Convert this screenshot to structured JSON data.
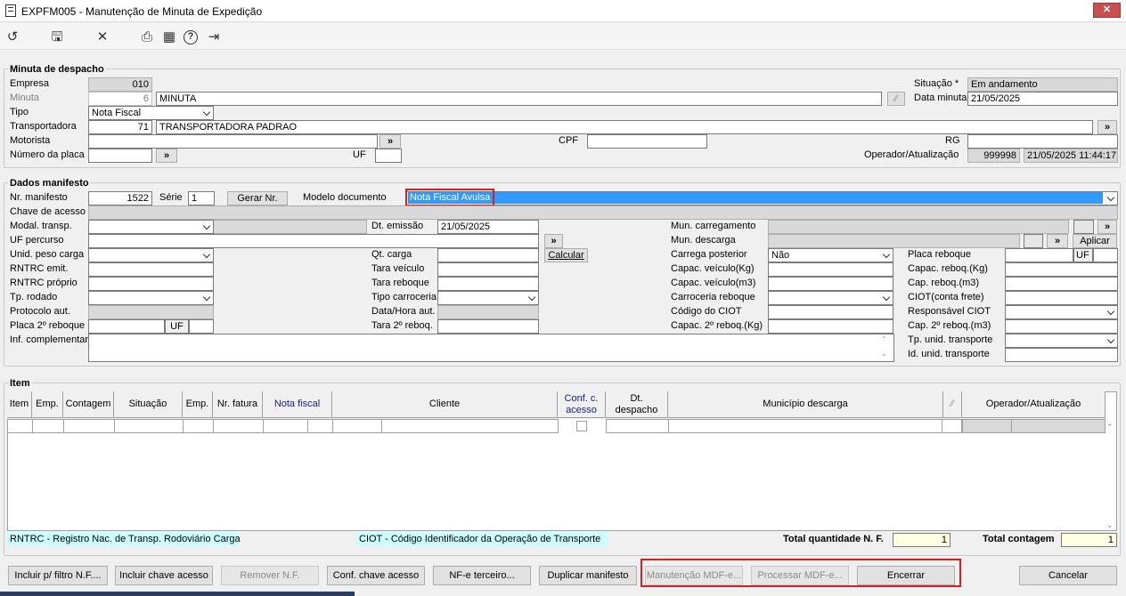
{
  "window": {
    "title": "EXPFM005 - Manutenção de Minuta de Expedição",
    "close": "✕"
  },
  "toolbar": {
    "icons": [
      "refresh-icon",
      "save-icon",
      "cancel-icon",
      "print-icon",
      "calendar-icon",
      "help-icon",
      "exit-icon"
    ],
    "glyphs": [
      "↺",
      "🖫",
      "✕",
      "⎙",
      "▦",
      "?",
      "⇥"
    ]
  },
  "minuta": {
    "title": "Minuta de despacho",
    "empresa_label": "Empresa",
    "empresa": "010",
    "minuta_label": "Minuta",
    "minuta_num": "6",
    "minuta_desc": "MINUTA",
    "tipo_label": "Tipo",
    "tipo": "Nota Fiscal",
    "transp_label": "Transportadora",
    "transp_code": "71",
    "transp_name": "TRANSPORTADORA PADRAO",
    "motorista_label": "Motorista",
    "cpf_label": "CPF",
    "rg_label": "RG",
    "placa_label": "Número da placa",
    "uf_label": "UF",
    "situacao_label": "Situação *",
    "situacao": "Em andamento",
    "data_label": "Data minuta",
    "data": "21/05/2025",
    "operador_label": "Operador/Atualização",
    "operador": "999998",
    "operador_dt": "21/05/2025 11:44:17"
  },
  "manifesto": {
    "title": "Dados manifesto",
    "nr_label": "Nr. manifesto",
    "nr": "1522",
    "serie_label": "Série",
    "serie": "1",
    "gerar": "Gerar Nr.",
    "modelo_label": "Modelo documento",
    "modelo": "Nota Fiscal Avulsa",
    "chave_label": "Chave de acesso",
    "modal_label": "Modal. transp.",
    "dtemissao_label": "Dt. emissão",
    "dtemissao": "21/05/2025",
    "uf_percurso_label": "UF percurso",
    "unid_label": "Unid. peso carga",
    "qtcarga_label": "Qt. carga",
    "calcular": "Calcular",
    "rntrc_emit_label": "RNTRC emit.",
    "tara_veic_label": "Tara veículo",
    "rntrc_prop_label": "RNTRC próprio",
    "tara_reb_label": "Tara reboque",
    "tp_rodado_label": "Tp. rodado",
    "tipo_carr_label": "Tipo carroceria",
    "protocolo_label": "Protocolo aut.",
    "datahora_label": "Data/Hora aut.",
    "placa2_label": "Placa 2º reboque",
    "uf2": "UF",
    "tara2_label": "Tara 2º reboq.",
    "inf_label": "Inf. complementar",
    "mun_carreg_label": "Mun. carregamento",
    "mun_desc_label": "Mun. descarga",
    "aplicar": "Aplicar",
    "carrega_post_label": "Carrega posterior",
    "carrega_post": "Não",
    "capac_kg_label": "Capac. veículo(Kg)",
    "capac_m3_label": "Capac. veículo(m3)",
    "carroc_reb_label": "Carroceria reboque",
    "ciot_label": "Código do CIOT",
    "capac2_label": "Capac. 2º reboq.(Kg)",
    "placa_reb_label": "Placa reboque",
    "uf3": "UF",
    "capac_reb_kg_label": "Capac. reboq.(Kg)",
    "cap_reb_m3_label": "Cap. reboq.(m3)",
    "ciot_frete_label": "CIOT(conta frete)",
    "resp_ciot_label": "Responsável CIOT",
    "cap2_m3_label": "Cap. 2º reboq.(m3)",
    "tp_unid_label": "Tp. unid. transporte",
    "id_unid_label": "Id. unid. transporte"
  },
  "item": {
    "title": "Item",
    "columns": [
      "Item",
      "Emp.",
      "Contagem",
      "Situação",
      "Emp.",
      "Nr. fatura",
      "Nota fiscal",
      "Cliente",
      "Conf. c. acesso",
      "Dt. despacho",
      "Município descarga",
      "⁄⁄",
      "Operador/Atualização"
    ],
    "legend_rntrc": "RNTRC - Registro Nac. de Transp. Rodoviário Carga",
    "legend_ciot": "CIOT - Código Identificador da Operação de Transporte",
    "total_nf_label": "Total quantidade N. F.",
    "total_nf": "1",
    "total_cont_label": "Total contagem",
    "total_cont": "1"
  },
  "footer": {
    "b1": "Incluir p/ filtro N.F....",
    "b2": "Incluir chave acesso",
    "b3": "Remover N.F.",
    "b4": "Conf. chave acesso",
    "b5": "NF-e terceiro...",
    "b6": "Duplicar manifesto",
    "b7": "Manutenção MDF-e...",
    "b8": "Processar MDF-e...",
    "b9": "Encerrar",
    "b10": "Cancelar"
  },
  "colors": {
    "highlight": "#3399ff",
    "red_box": "#d42020",
    "legend_bg": "#ccffff",
    "total_bg": "#ffffe1"
  }
}
